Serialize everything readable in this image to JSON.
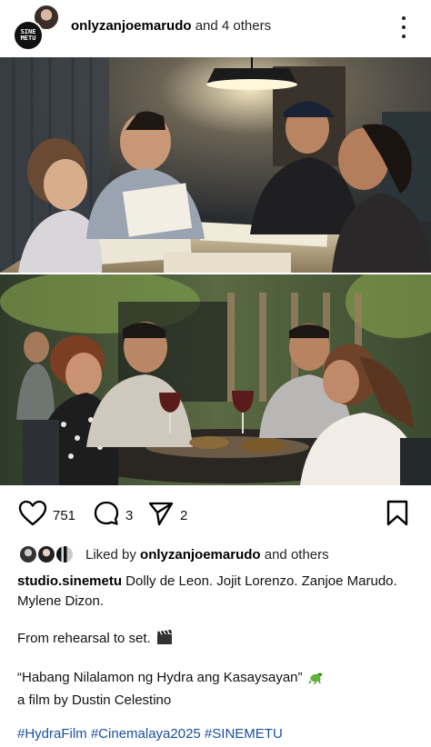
{
  "header": {
    "username": "onlyzanjoemarudo",
    "collab_text": " and 4 others",
    "logo_text_line1": "SINE",
    "logo_text_line2": "METU"
  },
  "photos": [
    {
      "name": "rehearsal-photo"
    },
    {
      "name": "set-dinner-photo"
    }
  ],
  "actions": {
    "likes": "751",
    "comments": "3",
    "shares": "2"
  },
  "liked_by": {
    "prefix": "Liked by ",
    "user": "onlyzanjoemarudo",
    "suffix": " and others"
  },
  "caption": {
    "author": "studio.sinemetu",
    "line1": " Dolly de Leon. Jojit Lorenzo. Zanjoe Marudo. Mylene Dizon.",
    "line2": "From rehearsal to set.",
    "line3": "“Habang Nilalamon ng Hydra ang Kasaysayan”",
    "line4": "a film by Dustin Celestino",
    "hashtags": "#HydraFilm #Cinemalaya2025 #SINEMETU"
  },
  "icons": {
    "like": "heart-icon",
    "comment": "comment-icon",
    "share": "send-icon",
    "save": "bookmark-icon",
    "clapper": "clapper-board-emoji",
    "dragon": "dragon-emoji"
  }
}
